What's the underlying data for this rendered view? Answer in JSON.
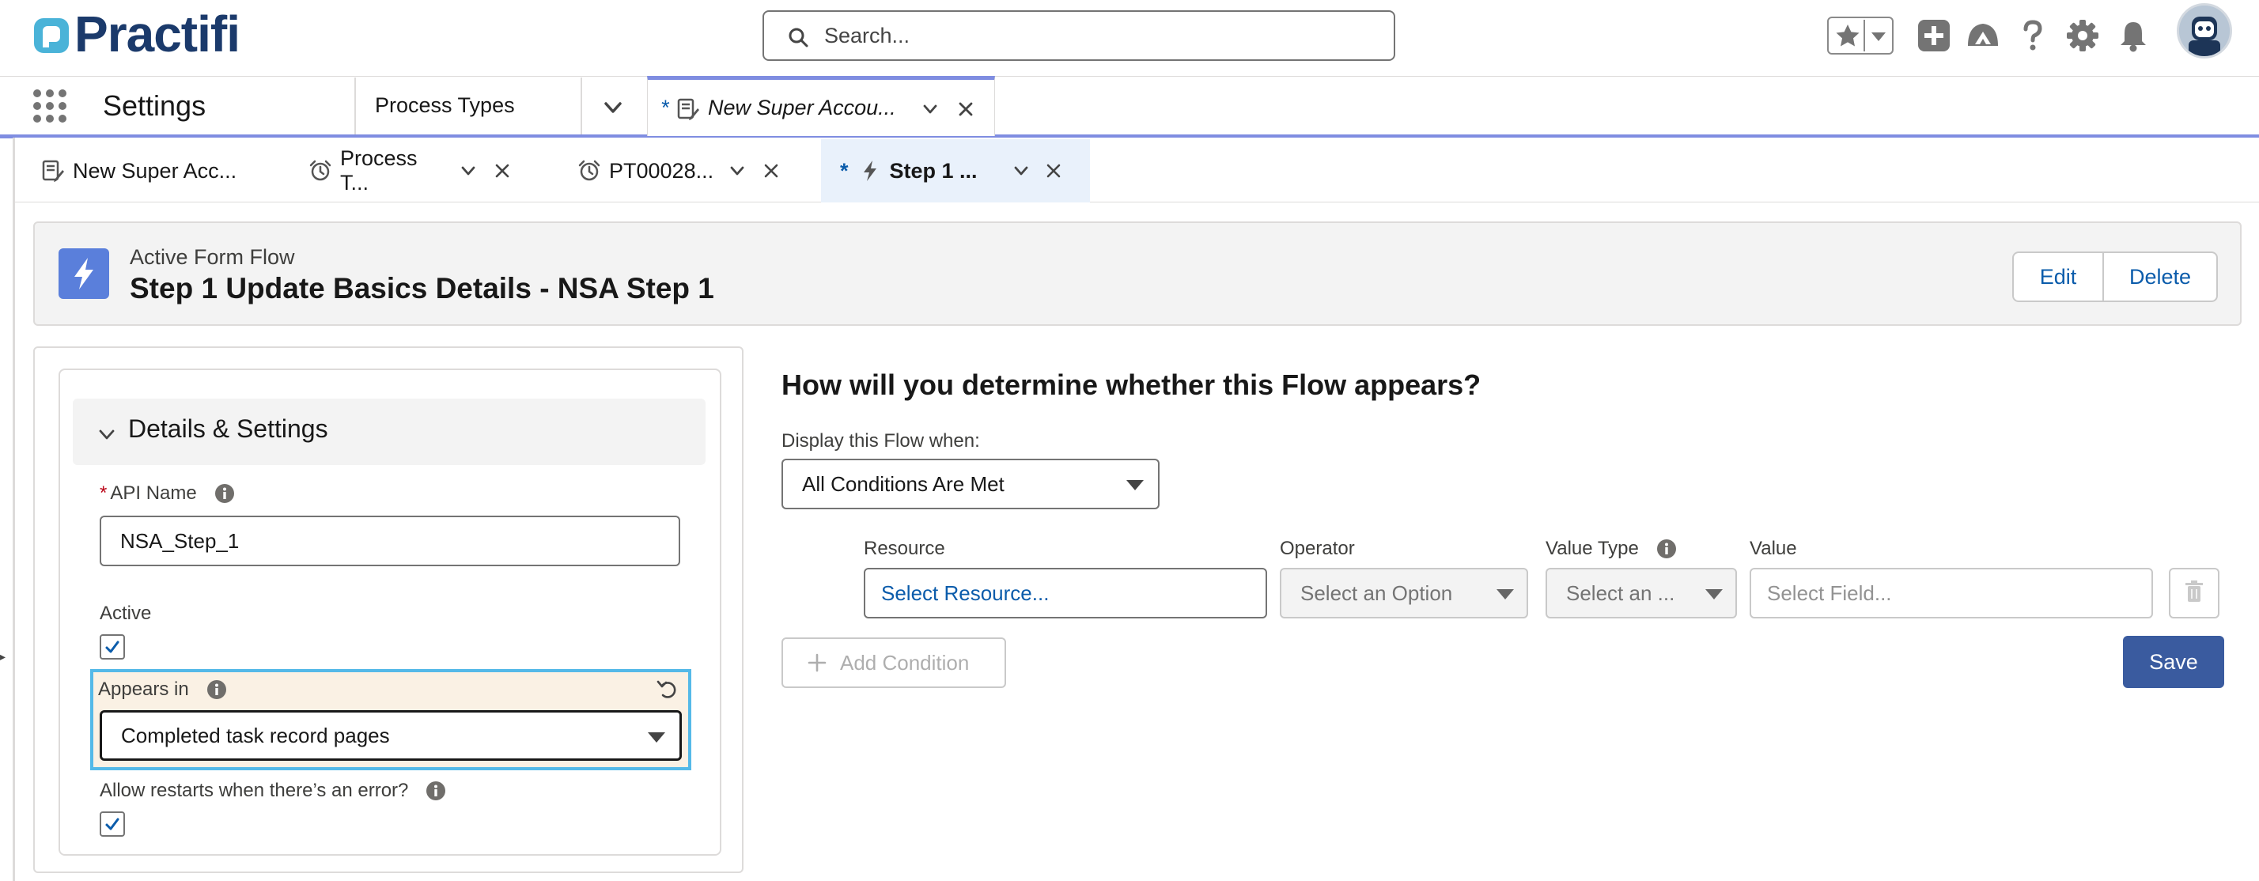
{
  "brand": {
    "name": "Practifi",
    "primary_color": "#1b3a6b",
    "accent_color": "#54b9e8"
  },
  "search": {
    "placeholder": "Search..."
  },
  "header_icons": [
    "star-icon",
    "chevron-down-icon",
    "add-icon",
    "trailhead-icon",
    "help-icon",
    "settings-icon",
    "notifications-icon",
    "avatar"
  ],
  "app_nav": {
    "app_name": "Settings",
    "items": [
      {
        "label": "Process Types"
      }
    ],
    "workspace_tab": {
      "modified_marker": "*",
      "label": "New Super Accou...",
      "icon": "record-icon"
    }
  },
  "subtabs": [
    {
      "label": "New Super Acc...",
      "icon": "record-icon",
      "modified": false
    },
    {
      "label": "Process T...",
      "icon": "alarm-clock-icon",
      "modified": false
    },
    {
      "label": "PT00028...",
      "icon": "alarm-clock-icon",
      "modified": false
    },
    {
      "label": "Step 1 ...",
      "icon": "flow-icon",
      "modified": true,
      "modified_marker": "*",
      "active": true
    }
  ],
  "record_header": {
    "eyebrow": "Active Form Flow",
    "title": "Step 1 Update Basics Details - NSA Step 1",
    "actions": {
      "edit": "Edit",
      "delete": "Delete"
    }
  },
  "details": {
    "section_title": "Details & Settings",
    "api_name": {
      "label": "API Name",
      "required": true,
      "value": "NSA_Step_1"
    },
    "active": {
      "label": "Active",
      "checked": true
    },
    "appears_in": {
      "label": "Appears in",
      "value": "Completed task record pages"
    },
    "allow_restarts": {
      "label": "Allow restarts when there’s an error?",
      "checked": true
    }
  },
  "visibility": {
    "question": "How will you determine whether this Flow appears?",
    "display_label": "Display this Flow when:",
    "display_value": "All Conditions Are Met",
    "columns": {
      "resource": "Resource",
      "operator": "Operator",
      "value_type": "Value Type",
      "value": "Value"
    },
    "row": {
      "resource_placeholder": "Select Resource...",
      "operator_placeholder": "Select an Option",
      "value_type_placeholder": "Select an ...",
      "value_placeholder": "Select Field..."
    },
    "add_condition": "Add Condition",
    "save": "Save"
  }
}
